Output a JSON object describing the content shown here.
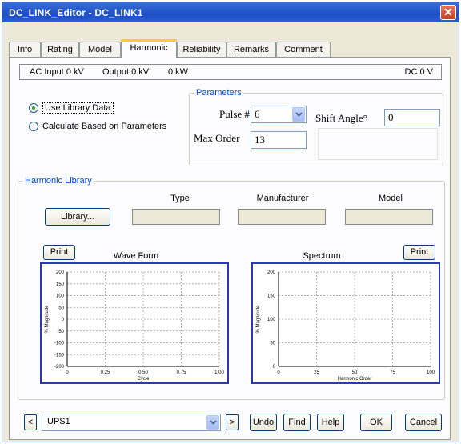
{
  "window": {
    "title": "DC_LINK_Editor - DC_LINK1",
    "close_glyph": "✕"
  },
  "tabs": [
    {
      "label": "Info"
    },
    {
      "label": "Rating"
    },
    {
      "label": "Model"
    },
    {
      "label": "Harmonic",
      "active": true
    },
    {
      "label": "Reliability"
    },
    {
      "label": "Remarks"
    },
    {
      "label": "Comment"
    }
  ],
  "status": {
    "ac_input": "AC Input 0 kV",
    "output_kv": "Output 0 kV",
    "output_kw": "0 kW",
    "dc": "DC 0 V"
  },
  "source": {
    "use_library": "Use Library Data",
    "calculate": "Calculate Based on Parameters",
    "selected": "use_library"
  },
  "parameters": {
    "legend": "Parameters",
    "pulse_label": "Pulse #",
    "pulse_value": "6",
    "shift_label": "Shift Angle°",
    "shift_value": "0",
    "max_order_label": "Max Order",
    "max_order_value": "13"
  },
  "library": {
    "legend": "Harmonic Library",
    "button": "Library...",
    "columns": [
      "Type",
      "Manufacturer",
      "Model"
    ],
    "values": [
      "",
      "",
      ""
    ]
  },
  "waveform": {
    "print": "Print",
    "title": "Wave Form",
    "xlabel": "Cycle",
    "ylabel": "% Magnitude",
    "yticks": [
      "200",
      "150",
      "100",
      "50",
      "0",
      "-50",
      "-100",
      "-150",
      "-200"
    ],
    "xticks": [
      "0",
      "0.25",
      "0.50",
      "0.75",
      "1.00"
    ]
  },
  "spectrum": {
    "print": "Print",
    "title": "Spectrum",
    "xlabel": "Harmonic Order",
    "ylabel": "% Magnitude",
    "yticks": [
      "200",
      "150",
      "100",
      "50",
      "0"
    ],
    "xticks": [
      "0",
      "25",
      "50",
      "75",
      "100"
    ]
  },
  "footer": {
    "prev": "<",
    "next": ">",
    "element": "UPS1",
    "undo": "Undo",
    "find": "Find",
    "help": "Help",
    "ok": "OK",
    "cancel": "Cancel"
  },
  "chart_data": [
    {
      "type": "line",
      "title": "Wave Form",
      "xlabel": "Cycle",
      "ylabel": "% Magnitude",
      "xlim": [
        0,
        1
      ],
      "ylim": [
        -200,
        200
      ],
      "x_ticks": [
        0,
        0.25,
        0.5,
        0.75,
        1.0
      ],
      "y_ticks": [
        200,
        150,
        100,
        50,
        0,
        -50,
        -100,
        -150,
        -200
      ],
      "grid": true,
      "series": []
    },
    {
      "type": "bar",
      "title": "Spectrum",
      "xlabel": "Harmonic Order",
      "ylabel": "% Magnitude",
      "xlim": [
        0,
        100
      ],
      "ylim": [
        0,
        200
      ],
      "x_ticks": [
        0,
        25,
        50,
        75,
        100
      ],
      "y_ticks": [
        200,
        150,
        100,
        50,
        0
      ],
      "grid": true,
      "series": []
    }
  ],
  "colors": {
    "title_bar": "#1c4fc6",
    "chart_border": "#2a3ab4",
    "legend_text": "#0046d5",
    "radio_dot": "#21a121"
  }
}
